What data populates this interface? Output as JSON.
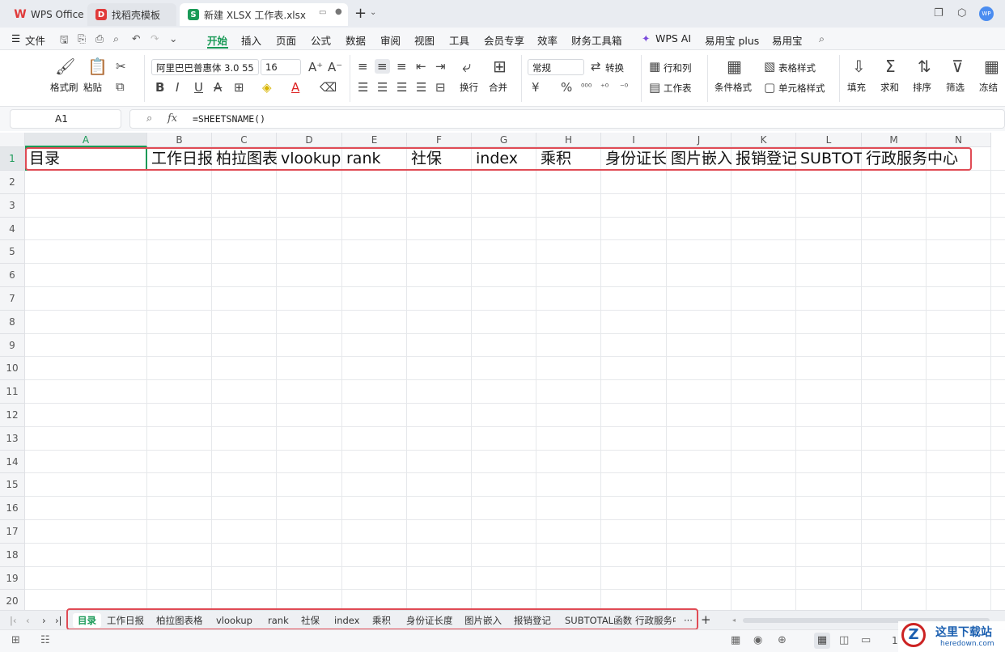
{
  "titlebar": {
    "tabs": [
      {
        "label": "WPS Office",
        "icon": "wps-logo-icon"
      },
      {
        "label": "找稻壳模板",
        "icon": "docer-logo-icon"
      },
      {
        "label": "新建 XLSX 工作表.xlsx",
        "icon": "sheet-logo-icon"
      }
    ],
    "new_tab": "+",
    "avatar_text": "WP",
    "colors": {
      "wps_red": "#e03a3a",
      "sheet_green": "#1a9a57",
      "avatar_blue": "#4a8cf0"
    }
  },
  "menubar": {
    "file_label": "文件",
    "tabs": [
      "开始",
      "插入",
      "页面",
      "公式",
      "数据",
      "审阅",
      "视图",
      "工具",
      "会员专享",
      "效率",
      "财务工具箱",
      "WPS AI",
      "易用宝 plus",
      "易用宝"
    ],
    "active_tab": "开始"
  },
  "ribbon": {
    "format_painter": "格式刷",
    "paste": "粘贴",
    "font_name": "阿里巴巴普惠体 3.0 55",
    "font_size": "16",
    "bold": "B",
    "italic": "I",
    "underline": "U",
    "strike": "A",
    "wrap": "换行",
    "merge": "合并",
    "number_format": "常规",
    "convert": "转换",
    "rows_cols": "行和列",
    "worksheet": "工作表",
    "cond_format": "条件格式",
    "table_style": "表格样式",
    "cell_style": "单元格样式",
    "fill": "填充",
    "sum": "求和",
    "sort": "排序",
    "filter": "筛选",
    "freeze": "冻结",
    "currency": "¥",
    "percent": "%"
  },
  "formulabar": {
    "name_box": "A1",
    "fx": "fx",
    "formula": "=SHEETSNAME()"
  },
  "grid": {
    "columns": [
      "A",
      "B",
      "C",
      "D",
      "E",
      "F",
      "G",
      "H",
      "I",
      "J",
      "K",
      "L",
      "M",
      "N"
    ],
    "rows": [
      "1",
      "2",
      "3",
      "4",
      "5",
      "6",
      "7",
      "8",
      "9",
      "10",
      "11",
      "12",
      "13",
      "14",
      "15",
      "16",
      "17",
      "18",
      "19",
      "20"
    ],
    "row1": [
      "目录",
      "工作日报",
      "柏拉图表格",
      "vlookup",
      "rank",
      "社保",
      "index",
      "乘积",
      "身份证长度",
      "图片嵌入",
      "报销登记",
      "SUBTOTAL函数",
      "行政服务中心",
      ""
    ]
  },
  "sheettabs": {
    "tabs": [
      "目录",
      "工作日报",
      "柏拉图表格",
      "vlookup",
      "rank",
      "社保",
      "index",
      "乘积",
      "身份证长度",
      "图片嵌入",
      "报销登记",
      "SUBTOTAL函数",
      "行政服务中"
    ],
    "active": "目录",
    "more": "···",
    "add": "+"
  },
  "statusbar": {
    "zoom_partial": "1"
  },
  "watermark": {
    "text": "这里下载站",
    "url_text": "heredown.com"
  },
  "highlight_color": "#e04b55"
}
